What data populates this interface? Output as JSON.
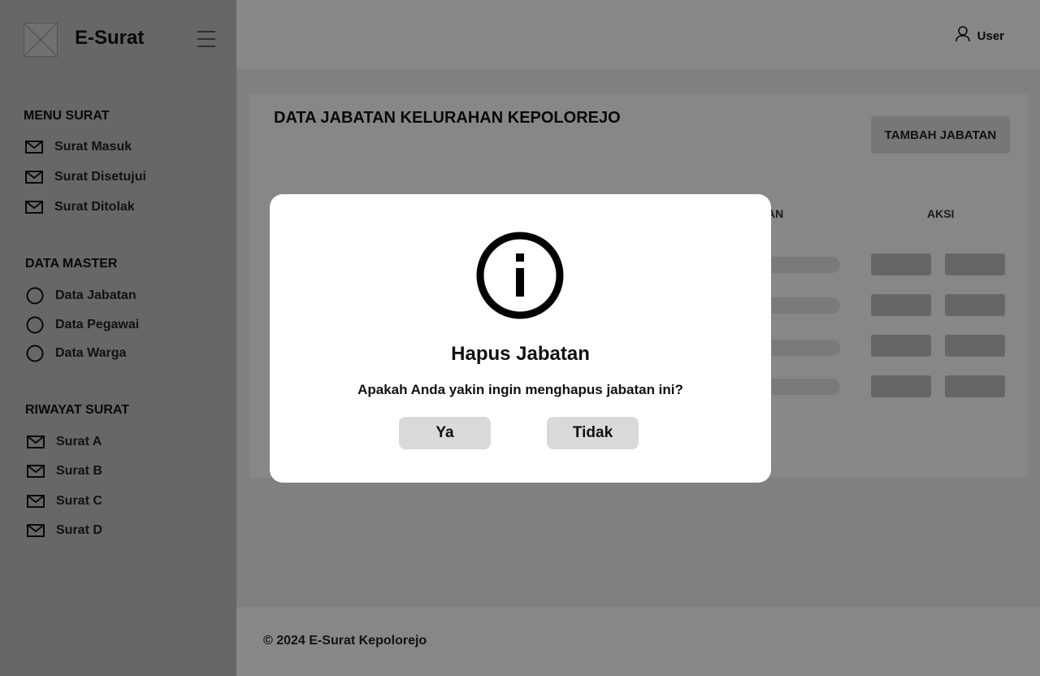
{
  "app": {
    "brand": "E-Surat"
  },
  "header": {
    "user_label": "User"
  },
  "sidebar": {
    "sections": [
      {
        "title": "MENU SURAT",
        "items": [
          {
            "label": "Surat Masuk",
            "icon": "mail-icon"
          },
          {
            "label": "Surat Disetujui",
            "icon": "mail-icon"
          },
          {
            "label": "Surat Ditolak",
            "icon": "mail-icon"
          }
        ]
      },
      {
        "title": "DATA MASTER",
        "items": [
          {
            "label": "Data Jabatan",
            "icon": "circle-icon"
          },
          {
            "label": "Data Pegawai",
            "icon": "circle-icon"
          },
          {
            "label": "Data Warga",
            "icon": "circle-icon"
          }
        ]
      },
      {
        "title": "RIWAYAT SURAT",
        "items": [
          {
            "label": "Surat A",
            "icon": "mail-icon"
          },
          {
            "label": "Surat B",
            "icon": "mail-icon"
          },
          {
            "label": "Surat C",
            "icon": "mail-icon"
          },
          {
            "label": "Surat D",
            "icon": "mail-icon"
          }
        ]
      }
    ]
  },
  "main": {
    "title": "DATA JABATAN KELURAHAN KEPOLOREJO",
    "add_button": "TAMBAH JABATAN",
    "columns": {
      "partial": "AN",
      "actions": "AKSI"
    }
  },
  "modal": {
    "icon": "info-icon",
    "title": "Hapus Jabatan",
    "message": "Apakah Anda yakin ingin menghapus jabatan ini?",
    "confirm": "Ya",
    "cancel": "Tidak"
  },
  "footer": {
    "text": "© 2024 E-Surat Kepolorejo"
  }
}
